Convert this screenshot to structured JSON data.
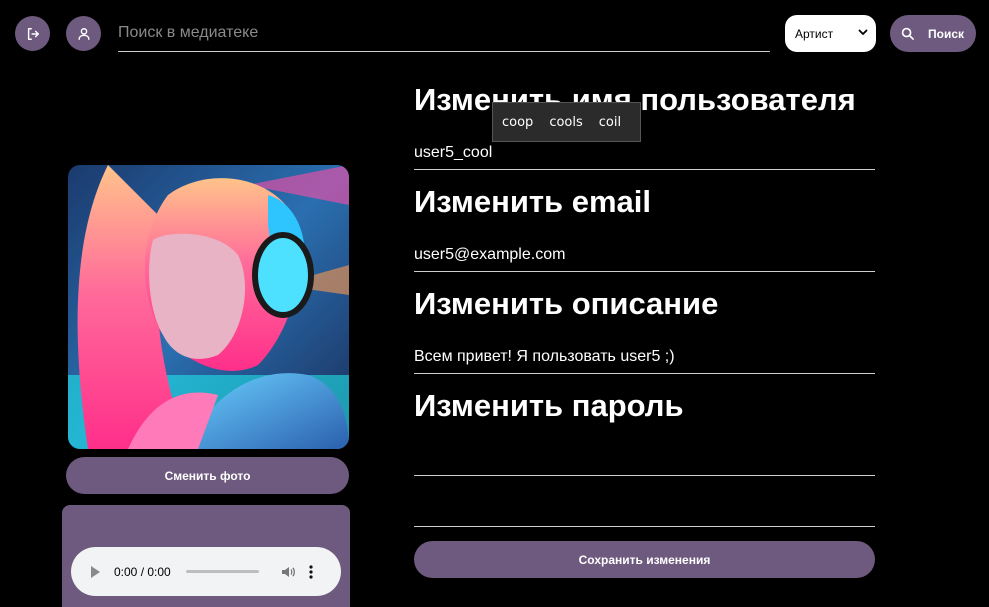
{
  "header": {
    "search_placeholder": "Поиск в медиатеке",
    "filter_selected": "Артист",
    "search_button": "Поиск"
  },
  "sidebar": {
    "change_photo_label": "Сменить фото",
    "audio_time": "0:00 / 0:00"
  },
  "form": {
    "username_title": "Изменить имя пользователя",
    "username_value": "user5_cool",
    "email_title": "Изменить email",
    "email_value": "user5@example.com",
    "description_title": "Изменить описание",
    "description_value": "Всем привет! Я пользовать user5 ;)",
    "password_title": "Изменить пароль",
    "password_value": "",
    "password_confirm_value": "",
    "save_label": "Сохранить изменения"
  },
  "spellcheck": {
    "suggestions": [
      "coop",
      "cools",
      "coil"
    ]
  },
  "colors": {
    "background": "#000000",
    "accent": "#6e5a7e"
  },
  "icons": {
    "logout": "logout-icon",
    "profile": "user-icon",
    "search": "search-icon",
    "chevron": "chevron-down-icon"
  }
}
